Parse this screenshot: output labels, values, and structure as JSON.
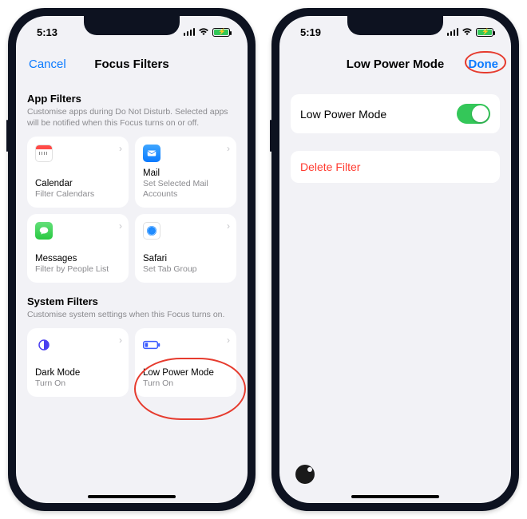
{
  "left": {
    "time": "5:13",
    "nav": {
      "cancel": "Cancel",
      "title": "Focus Filters"
    },
    "appFilters": {
      "heading": "App Filters",
      "sub": "Customise apps during Do Not Disturb. Selected apps will be notified when this Focus turns on or off.",
      "items": [
        {
          "title": "Calendar",
          "sub": "Filter Calendars"
        },
        {
          "title": "Mail",
          "sub": "Set Selected Mail Accounts"
        },
        {
          "title": "Messages",
          "sub": "Filter by People List"
        },
        {
          "title": "Safari",
          "sub": "Set Tab Group"
        }
      ]
    },
    "systemFilters": {
      "heading": "System Filters",
      "sub": "Customise system settings when this Focus turns on.",
      "items": [
        {
          "title": "Dark Mode",
          "sub": "Turn On"
        },
        {
          "title": "Low Power Mode",
          "sub": "Turn On"
        }
      ]
    }
  },
  "right": {
    "time": "5:19",
    "nav": {
      "title": "Low Power Mode",
      "done": "Done"
    },
    "rowLabel": "Low Power Mode",
    "toggleOn": true,
    "delete": "Delete Filter"
  }
}
